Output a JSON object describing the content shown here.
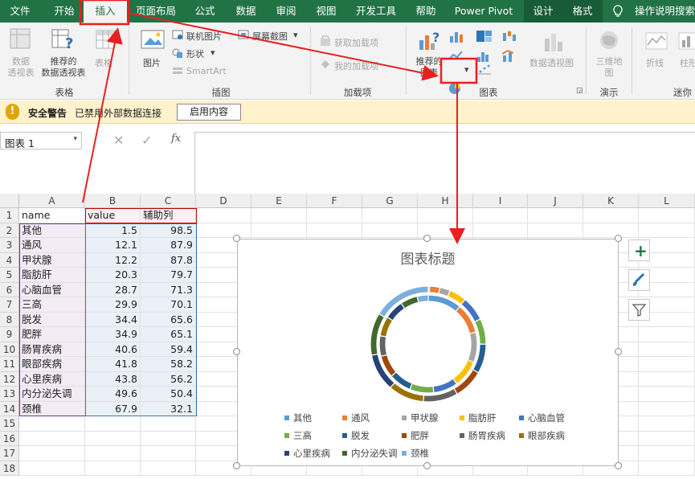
{
  "tabs": [
    "文件",
    "开始",
    "插入",
    "页面布局",
    "公式",
    "数据",
    "审阅",
    "视图",
    "开发工具",
    "帮助",
    "Power Pivot",
    "设计",
    "格式"
  ],
  "tell_me": "操作说明搜索",
  "ribbon": {
    "pivot": "数据\n透视表",
    "rec_pivot": "推荐的\n数据透视表",
    "table": "表格",
    "picture": "图片",
    "online_pic": "联机图片",
    "shapes": "形状",
    "smartart": "SmartArt",
    "screenshot": "屏幕截图",
    "get_addins": "获取加载项",
    "my_addins": "我的加载项",
    "rec_charts": "推荐的\n图表",
    "pivot_chart": "数据透视图",
    "map3d": "三维地\n图",
    "sparkline_line": "折线",
    "sparkline_col": "柱形",
    "groups": {
      "tables": "表格",
      "illustrations": "插图",
      "addins": "加载项",
      "charts": "图表",
      "tours": "演示",
      "sparklines": "迷你"
    }
  },
  "security": {
    "title": "安全警告",
    "message": "已禁用外部数据连接",
    "button": "启用内容"
  },
  "namebox": "图表 1",
  "fx": "fx",
  "columns": [
    "A",
    "B",
    "C",
    "D",
    "E",
    "F",
    "G",
    "H",
    "I",
    "J",
    "K",
    "L"
  ],
  "rows": [
    "1",
    "2",
    "3",
    "4",
    "5",
    "6",
    "7",
    "8",
    "9",
    "10",
    "11",
    "12",
    "13",
    "14",
    "15",
    "16",
    "17",
    "18"
  ],
  "table": {
    "header": [
      "name",
      "value",
      "辅助列"
    ],
    "rows": [
      [
        "其他",
        "1.5",
        "98.5"
      ],
      [
        "通风",
        "12.1",
        "87.9"
      ],
      [
        "甲状腺",
        "12.2",
        "87.8"
      ],
      [
        "脂肪肝",
        "20.3",
        "79.7"
      ],
      [
        "心脑血管",
        "28.7",
        "71.3"
      ],
      [
        "三高",
        "29.9",
        "70.1"
      ],
      [
        "脱发",
        "34.4",
        "65.6"
      ],
      [
        "肥胖",
        "34.9",
        "65.1"
      ],
      [
        "肠胃疾病",
        "40.6",
        "59.4"
      ],
      [
        "眼部疾病",
        "41.8",
        "58.2"
      ],
      [
        "心里疾病",
        "43.8",
        "56.2"
      ],
      [
        "内分泌失调",
        "49.6",
        "50.4"
      ],
      [
        "颈椎",
        "67.9",
        "32.1"
      ]
    ]
  },
  "chart_data": {
    "type": "doughnut",
    "title": "图表标题",
    "categories": [
      "其他",
      "通风",
      "甲状腺",
      "脂肪肝",
      "心脑血管",
      "三高",
      "脱发",
      "肥胖",
      "肠胃疾病",
      "眼部疾病",
      "心里疾病",
      "内分泌失调",
      "颈椎"
    ],
    "colors": [
      "#5b9bd5",
      "#ed7d31",
      "#a5a5a5",
      "#ffc000",
      "#4472c4",
      "#70ad47",
      "#255e91",
      "#9e480e",
      "#636363",
      "#997300",
      "#264478",
      "#43682b",
      "#7cafdd"
    ],
    "series": [
      {
        "name": "value",
        "values": [
          1.5,
          12.1,
          12.2,
          20.3,
          28.7,
          29.9,
          34.4,
          34.9,
          40.6,
          41.8,
          43.8,
          49.6,
          67.9
        ]
      },
      {
        "name": "辅助列",
        "values": [
          98.5,
          87.9,
          87.8,
          79.7,
          71.3,
          70.1,
          65.6,
          65.1,
          59.4,
          58.2,
          56.2,
          50.4,
          32.1
        ]
      }
    ],
    "legend": "bottom"
  }
}
